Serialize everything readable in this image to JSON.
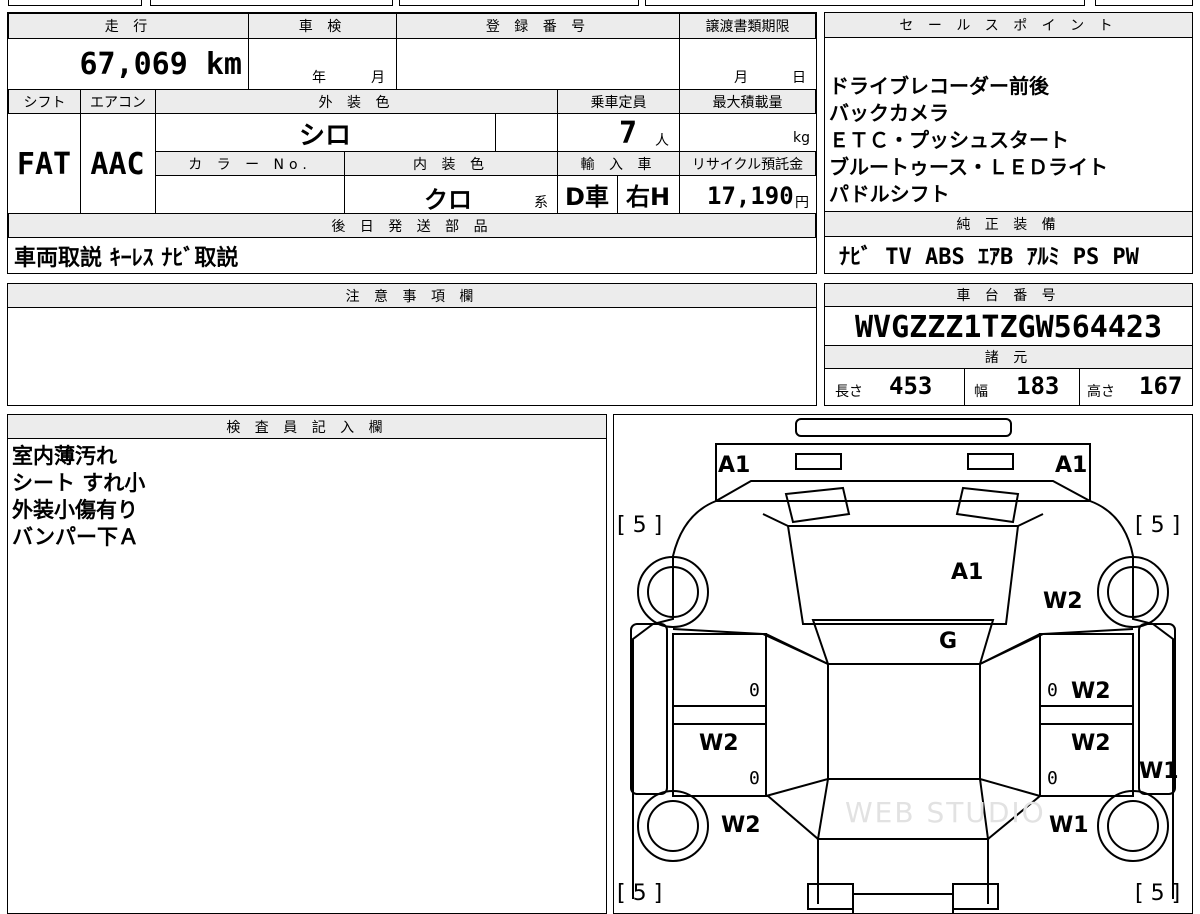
{
  "vehicle": {
    "mileage_header": "走 行",
    "mileage": "67,069 km",
    "inspection_header": "車 検",
    "inspection_year_unit": "年",
    "inspection_month_unit": "月",
    "registration_header": "登 録 番 号",
    "registration_number": "",
    "transfer_header": "譲渡書類期限",
    "transfer_month_unit": "月",
    "transfer_day_unit": "日",
    "shift_header": "シフト",
    "shift": "FAT",
    "ac_header": "エアコン",
    "ac": "AAC",
    "exterior_color_header": "外 装 色",
    "exterior_color": "シロ",
    "color_no_header": "カ ラ ー No.",
    "color_no": "",
    "interior_color_header": "内 装 色",
    "interior_color": "クロ",
    "interior_color_suffix": "系",
    "capacity_header": "乗車定員",
    "capacity": "7",
    "capacity_unit": "人",
    "max_load_header": "最大積載量",
    "max_load_unit": "kg",
    "import_header": "輸 入 車",
    "import_type": "D車",
    "steering": "右H",
    "recycle_header": "リサイクル預託金",
    "recycle_fee": "17,190",
    "recycle_unit": "円"
  },
  "sales_points": {
    "header": "セ ー ル ス ポ イ ン ト",
    "items": [
      "ドライブレコーダー前後",
      "バックカメラ",
      "ＥＴＣ・プッシュスタート",
      "ブルートゥース・ＬＥＤライト",
      "パドルシフト"
    ]
  },
  "later_parts": {
    "header": "後 日 発 送 部 品",
    "value": "車両取説 ｷｰﾚｽ ﾅﾋﾞ取説"
  },
  "genuine_equipment": {
    "header": "純 正 装 備",
    "value": "ﾅﾋﾞ TV ABS ｴｱB ｱﾙﾐ PS PW"
  },
  "notes": {
    "header": "注 意 事 項 欄",
    "value": ""
  },
  "chassis": {
    "header": "車 台 番 号",
    "number": "WVGZZZ1TZGW564423",
    "specs_header": "諸 元",
    "length_label": "長さ",
    "length": "453",
    "width_label": "幅",
    "width": "183",
    "height_label": "高さ",
    "height": "167"
  },
  "inspector": {
    "header": "検 査 員 記 入 欄",
    "lines": [
      "室内薄汚れ",
      "シート すれ小",
      "外装小傷有り",
      "バンパー下Ａ"
    ]
  },
  "diagram": {
    "marks": {
      "front_left": "A1",
      "front_right": "A1",
      "hood": "A1",
      "right_fender": "W2",
      "windshield": "G",
      "right_front_door": "W2",
      "left_rear_door": "W2",
      "right_rear_door": "W2",
      "right_rocker": "W1",
      "left_rear_fender": "W2",
      "right_rear_fender": "W1",
      "zero_lf": "0",
      "zero_rf": "0",
      "zero_lr": "0",
      "zero_rr": "0"
    },
    "tire_marks": {
      "tl": "[ 5 ]",
      "tr": "[ 5 ]",
      "bl": "[ 5 ]",
      "br": "[ 5 ]"
    },
    "watermark": "WEB STUDIO"
  }
}
